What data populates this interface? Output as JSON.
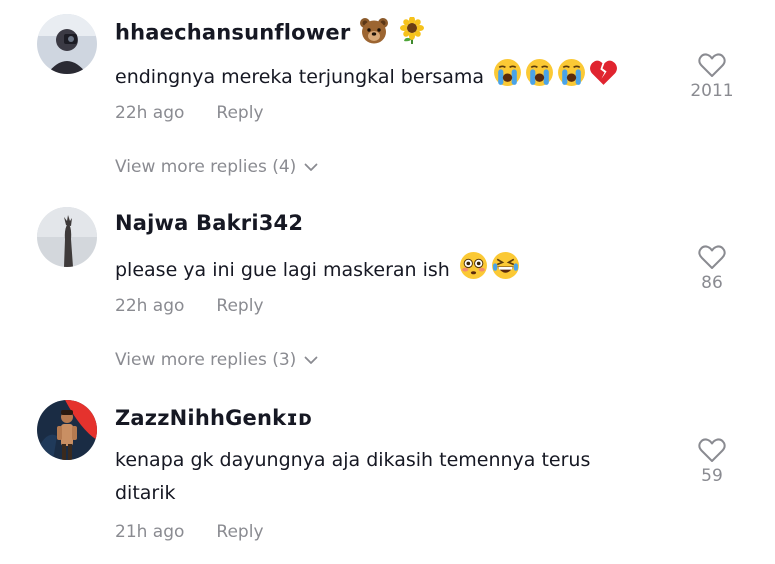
{
  "comments": [
    {
      "username": "hhaechansunflower",
      "username_icons": [
        "bear-face-icon",
        "sunflower-icon"
      ],
      "text": "endingnya mereka terjungkal bersama",
      "text_icons": [
        "loudly-crying-face-icon",
        "loudly-crying-face-icon",
        "loudly-crying-face-icon",
        "broken-heart-icon"
      ],
      "time": "22h ago",
      "reply_label": "Reply",
      "likes": "2011",
      "more_replies": "View more replies (4)"
    },
    {
      "username": "Najwa Bakri342",
      "text": "please ya ini gue lagi maskeran ish",
      "text_icons": [
        "flushed-face-icon",
        "grinning-squinting-face-icon"
      ],
      "time": "22h ago",
      "reply_label": "Reply",
      "likes": "86",
      "more_replies": "View more replies (3)"
    },
    {
      "username": "ZazzNihhGenkɪᴅ",
      "text_line1": "kenapa gk dayungnya aja dikasih temennya terus",
      "text_line2": "ditarik",
      "time": "21h ago",
      "reply_label": "Reply",
      "likes": "59"
    }
  ],
  "colors": {
    "text": "#161823",
    "muted": "#8a8b91",
    "avatar3_bg": "#e5322d"
  }
}
